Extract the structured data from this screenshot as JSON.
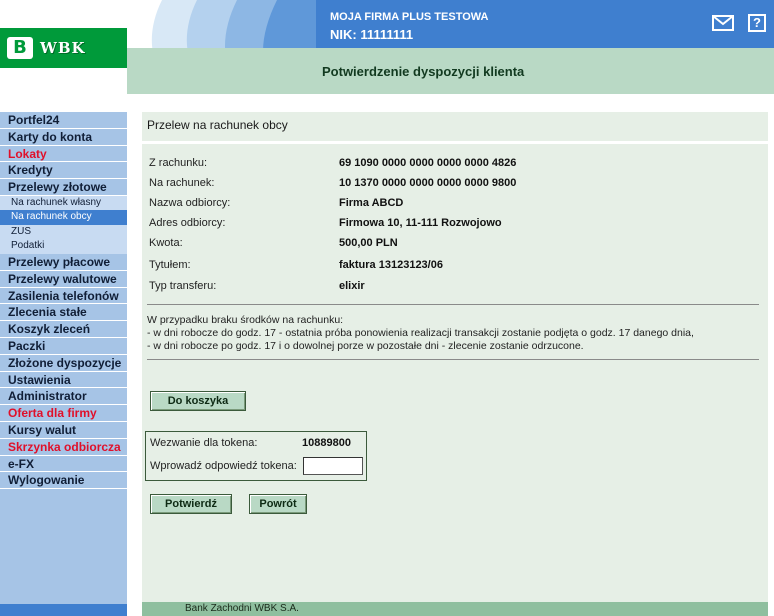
{
  "header": {
    "logo_mark": "B",
    "logo_text": "WBK",
    "company_name": "MOJA FIRMA PLUS TESTOWA",
    "nik": "NIK: 11111111",
    "page_title": "Potwierdzenie dyspozycji klienta",
    "help_icon_glyph": "?",
    "colors": {
      "topbar": "#3f7fcf",
      "subbar": "#b9d9c5",
      "logo": "#009a3a"
    }
  },
  "sidebar": {
    "items": [
      {
        "label": "Portfel24"
      },
      {
        "label": "Karty do konta"
      },
      {
        "label": "Lokaty",
        "color": "red"
      },
      {
        "label": "Kredyty"
      },
      {
        "label": "Przelewy złotowe"
      },
      {
        "label": "Na rachunek własny",
        "sub": true
      },
      {
        "label": "Na rachunek obcy",
        "sub": true,
        "active": true
      },
      {
        "label": "ZUS",
        "sub": true
      },
      {
        "label": "Podatki",
        "sub": true
      },
      {
        "label": "Przelewy płacowe"
      },
      {
        "label": "Przelewy walutowe"
      },
      {
        "label": "Zasilenia telefonów"
      },
      {
        "label": "Zlecenia stałe"
      },
      {
        "label": "Koszyk zleceń"
      },
      {
        "label": "Paczki"
      },
      {
        "label": "Złożone dyspozycje"
      },
      {
        "label": "Ustawienia"
      },
      {
        "label": "Administrator"
      },
      {
        "label": "Oferta dla firmy",
        "color": "red"
      },
      {
        "label": "Kursy walut"
      },
      {
        "label": "Skrzynka odbiorcza",
        "color": "red"
      },
      {
        "label": "e-FX"
      },
      {
        "label": "Wylogowanie"
      }
    ]
  },
  "main": {
    "section_title": "Przelew na rachunek obcy",
    "fields": [
      {
        "label": "Z rachunku:",
        "value": "69 1090 0000 0000 0000 0000 4826"
      },
      {
        "label": "Na rachunek:",
        "value": "10 1370 0000 0000 0000 0000 9800"
      },
      {
        "label": "Nazwa odbiorcy:",
        "value": "Firma ABCD"
      },
      {
        "label": "Adres odbiorcy:",
        "value": "Firmowa 10, 11-111 Rozwojowo"
      },
      {
        "label": "Kwota:",
        "value": "500,00 PLN"
      },
      {
        "label": "Tytułem:",
        "value": "faktura 13123123/06"
      },
      {
        "label": "Typ transferu:",
        "value": "elixir"
      }
    ],
    "notice": [
      "W przypadku braku środków na rachunku:",
      "- w dni robocze do godz. 17 - ostatnia próba ponowienia realizacji transakcji zostanie podjęta o godz. 17 danego dnia,",
      "- w dni robocze po godz. 17 i o dowolnej porze w pozostałe dni - zlecenie zostanie odrzucone."
    ],
    "basket_button": "Do koszyka",
    "token": {
      "challenge_label": "Wezwanie dla tokena:",
      "challenge_value": "10889800",
      "answer_label": "Wprowadź odpowiedź tokena:",
      "answer_value": ""
    },
    "confirm_button": "Potwierdź",
    "back_button": "Powrót"
  },
  "footer": {
    "text": "Bank Zachodni WBK S.A."
  }
}
